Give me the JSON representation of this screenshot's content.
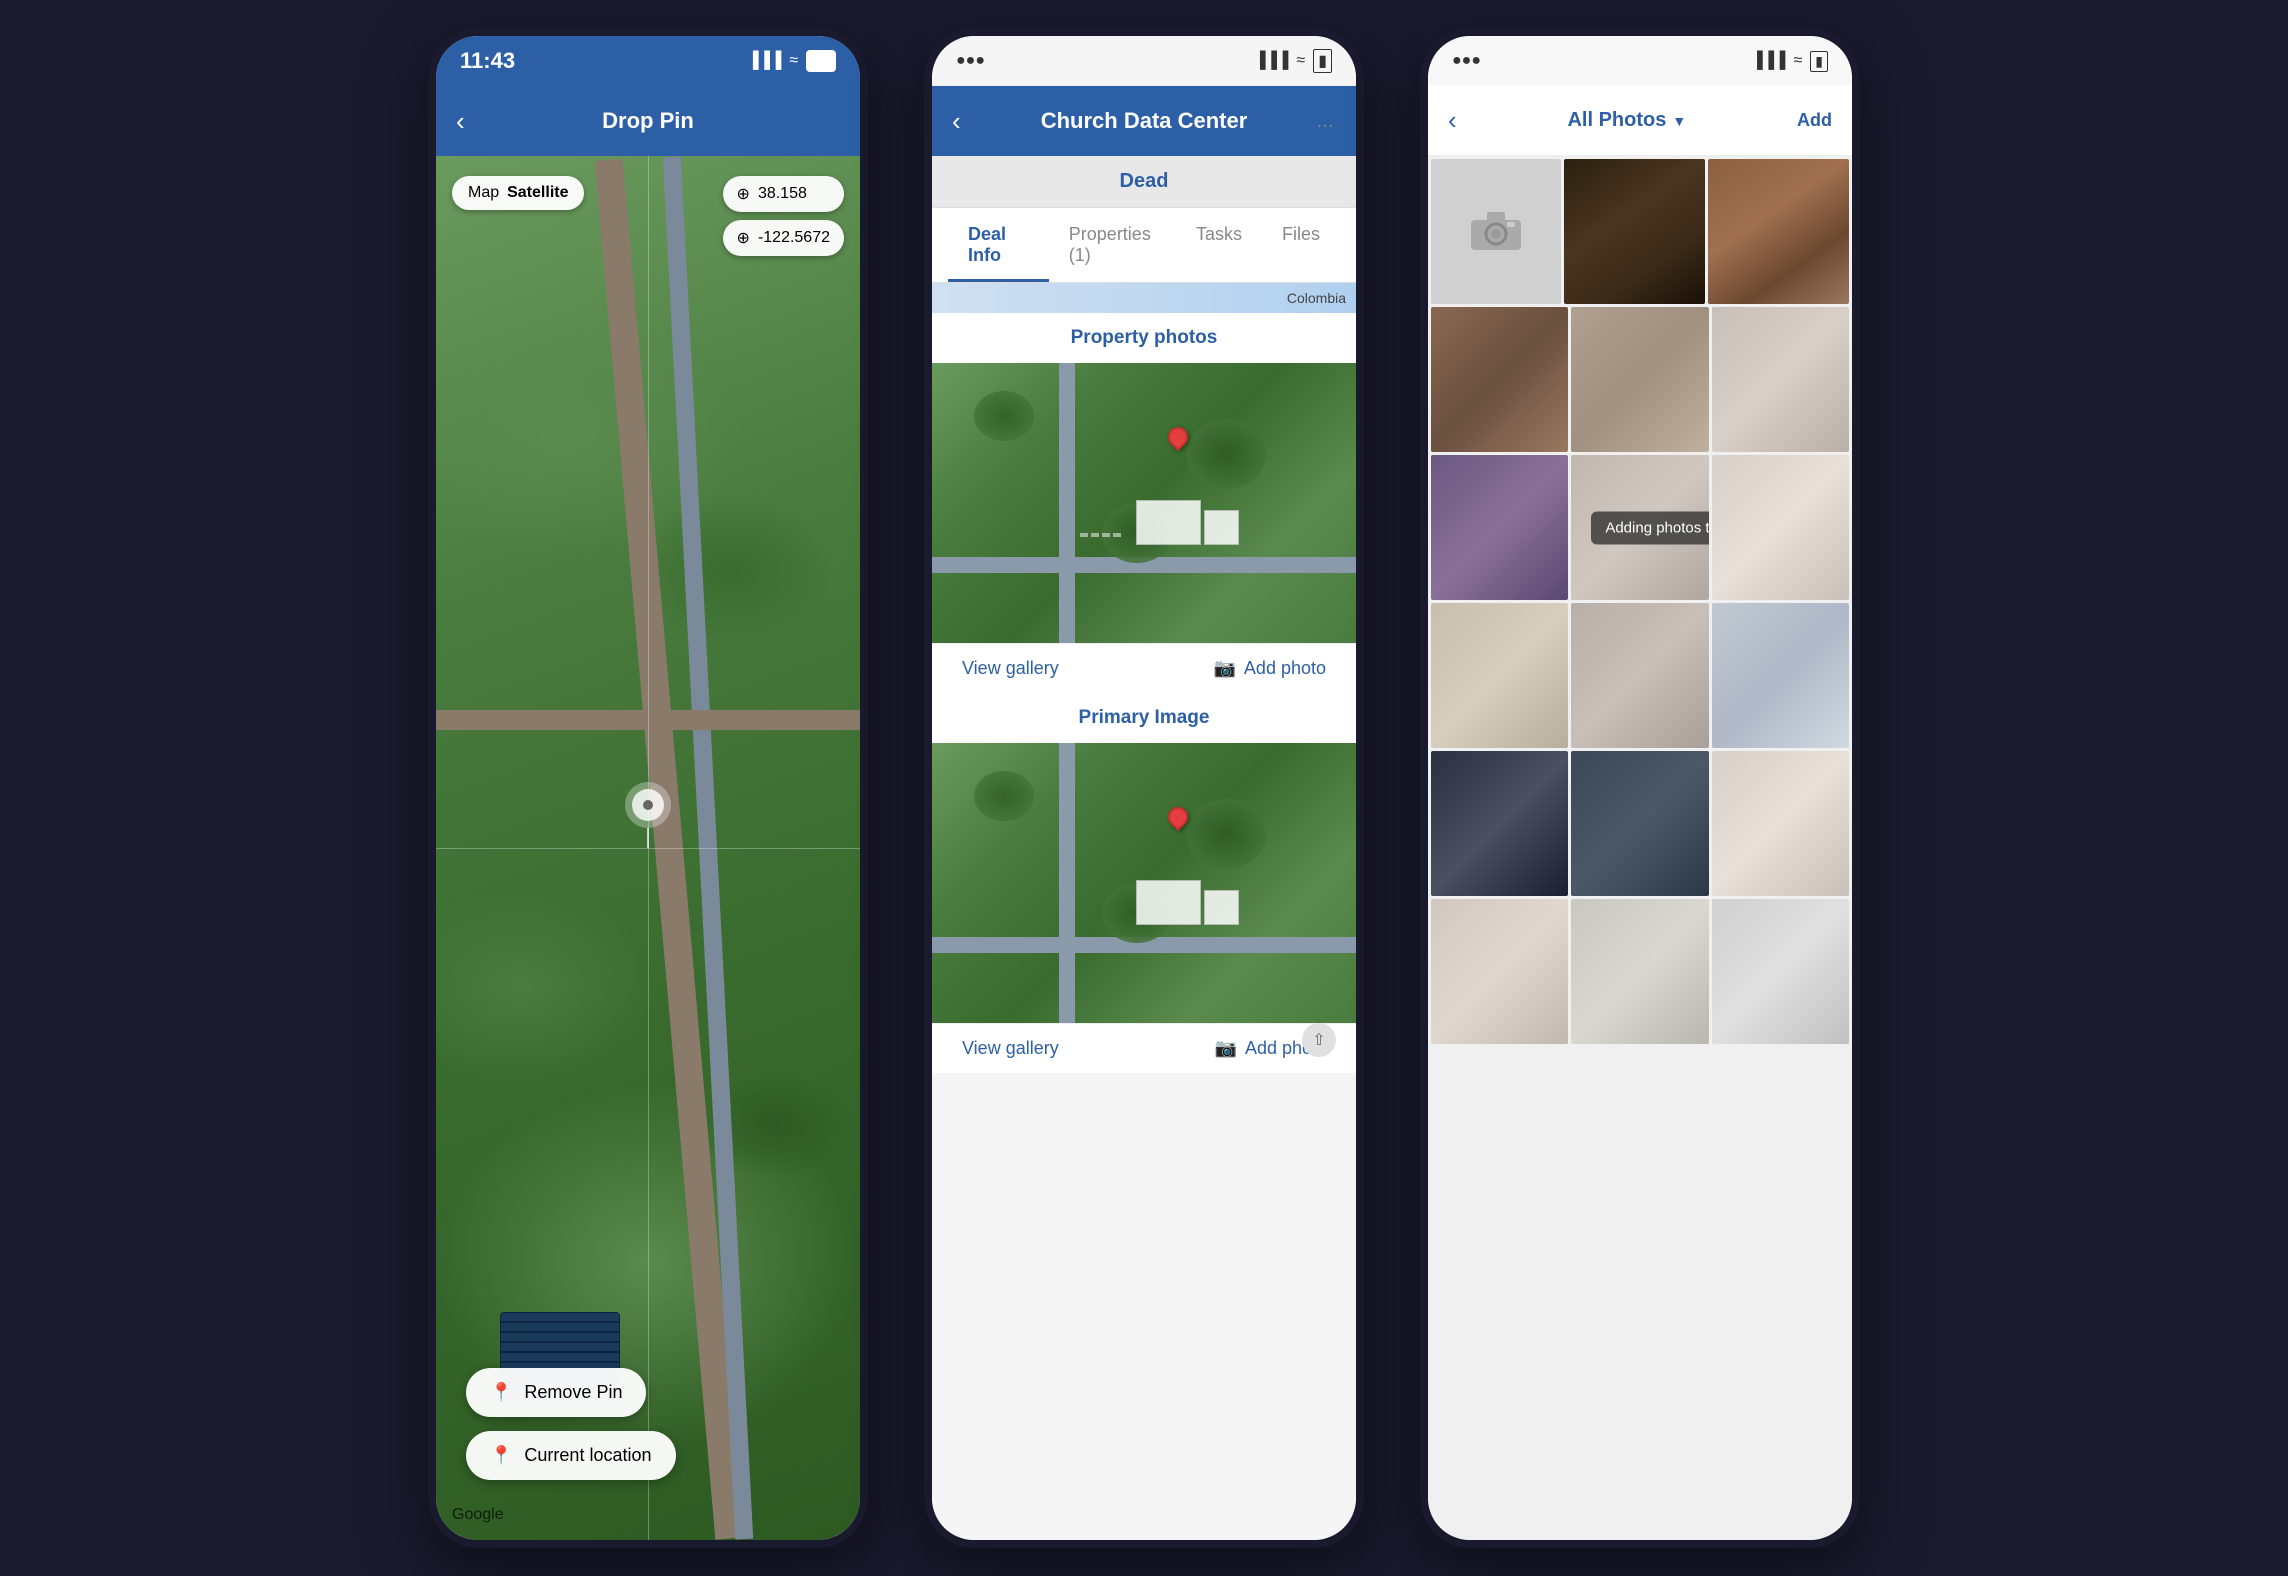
{
  "phone1": {
    "status": {
      "time": "11:43",
      "signal": "▐▐▐▐",
      "wifi": "WiFi",
      "battery": "85"
    },
    "nav": {
      "title": "Drop Pin",
      "back": "<"
    },
    "map": {
      "type_map": "Map",
      "type_satellite": "Satellite",
      "coord_lat": "38.158",
      "coord_lon": "-122.5672",
      "google": "Google"
    },
    "actions": {
      "remove_pin": "Remove Pin",
      "current_location": "Current location"
    }
  },
  "phone2": {
    "status": {
      "time": "",
      "signal": "▐▐▐▐",
      "wifi": "WiFi",
      "battery": ""
    },
    "nav": {
      "title": "Church Data Center",
      "back": "<"
    },
    "deal": {
      "status": "Dead",
      "tabs": [
        "Deal Info",
        "Properties (1)",
        "Tasks",
        "Files"
      ],
      "active_tab": "Deal Info"
    },
    "sections": {
      "property_photos": "Property photos",
      "primary_image": "Primary Image"
    },
    "actions": {
      "view_gallery": "View gallery",
      "add_photo": "Add photo",
      "view_gallery2": "View gallery",
      "add_photo2": "Add photc"
    },
    "map_label": "Colombia"
  },
  "phone3": {
    "status": {
      "time": "",
      "signal": "▐▐▐▐",
      "wifi": "WiFi",
      "battery": ""
    },
    "nav": {
      "title": "All Photos",
      "back": "<",
      "add": "Add"
    },
    "tooltip": "Adding photos to deal"
  }
}
